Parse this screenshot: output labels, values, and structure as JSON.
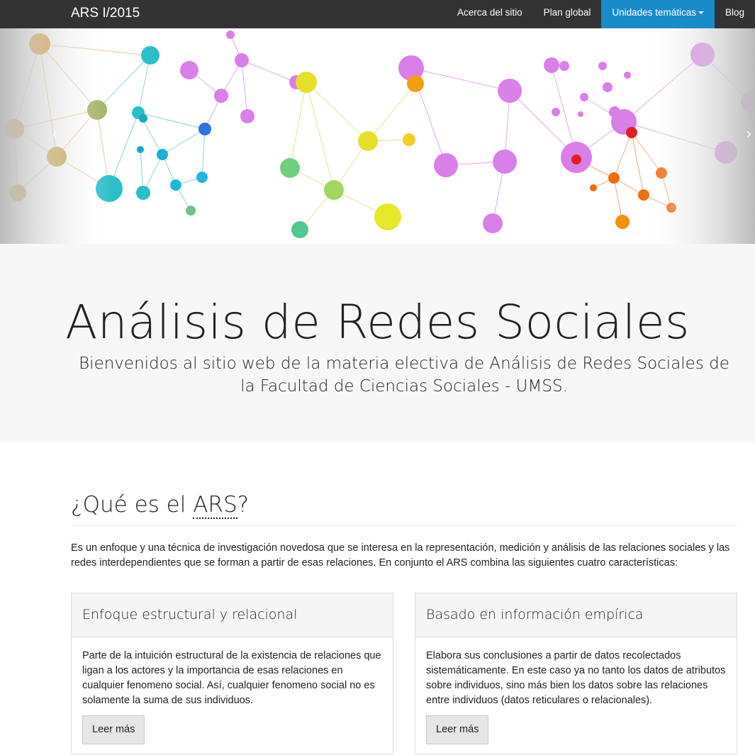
{
  "navbar": {
    "brand": "ARS I/2015",
    "items": [
      {
        "label": "Acerca del sitio"
      },
      {
        "label": "Plan global"
      },
      {
        "label": "Unidades temáticas"
      },
      {
        "label": "Blog"
      }
    ]
  },
  "hero": {
    "title": "Análisis de Redes Sociales",
    "subtitle": "Bienvenidos al sitio web de la materia electiva de Análisis de Redes Sociales de la Facultad de Ciencias Sociales - UMSS."
  },
  "carousel": {
    "prev_icon": "chevron-left-icon",
    "next_icon": "chevron-right-icon",
    "prev_glyph": "‹",
    "next_glyph": "›"
  },
  "section": {
    "title_prefix": "¿Qué es el ",
    "title_abbr": "ARS",
    "title_suffix": "?",
    "intro": "Es un enfoque y una técnica de investigación novedosa que se interesa en la representación, medición y análisis de las relaciones sociales y las redes interdependientes que se forman a partir de esas relaciones. En conjunto el ARS combina las siguientes cuatro características:"
  },
  "panels": [
    {
      "title": "Enfoque estructural y relacional",
      "body": "Parte de la intuición estructural de la existencia de relaciones que ligan a los actores y la importancia de esas relaciones en cualquier fenomeno social. Así, cualquier fenomeno social no es solamente la suma de sus individuos.",
      "button": "Leer más"
    },
    {
      "title": "Basado en información empírica",
      "body": "Elabora sus conclusiones a partir de datos recolectados sistemáticamente. En este caso ya no tanto los datos de atributos sobre individuos, sino más bien los datos sobre las relaciones entre individuos (datos reticulares o relacionales).",
      "button": "Leer más"
    }
  ],
  "colors": {
    "navbar": "#333333",
    "active": "#1a8bc9",
    "orange": "#e0901a",
    "teal": "#2bbfc9",
    "purple": "#d97fe8",
    "yellow": "#e6e02a",
    "red_orange": "#f36a10"
  }
}
